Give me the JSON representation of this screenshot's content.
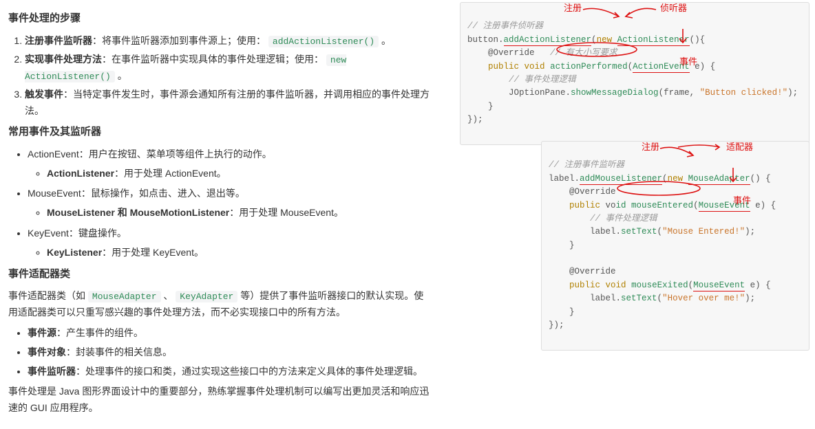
{
  "section1": {
    "title": "事件处理的步骤",
    "items": [
      {
        "label": "注册事件监听器",
        "desc": "：将事件监听器添加到事件源上；使用：",
        "code": "addActionListener()",
        "tail": "。"
      },
      {
        "label": "实现事件处理方法",
        "desc": "：在事件监听器中实现具体的事件处理逻辑；使用：",
        "code": "new ActionListener()",
        "tail": "。"
      },
      {
        "label": "触发事件",
        "desc": "：当特定事件发生时，事件源会通知所有注册的事件监听器，并调用相应的事件处理方法。",
        "code": "",
        "tail": ""
      }
    ]
  },
  "section2": {
    "title": "常用事件及其监听器",
    "items": [
      {
        "main": "ActionEvent：用户在按钮、菜单项等组件上执行的动作。",
        "sub": "ActionListener",
        "sub_tail": "：用于处理 ActionEvent。"
      },
      {
        "main": "MouseEvent：鼠标操作，如点击、进入、退出等。",
        "sub": "MouseListener 和 MouseMotionListener",
        "sub_tail": "：用于处理 MouseEvent。"
      },
      {
        "main": "KeyEvent：键盘操作。",
        "sub": "KeyListener",
        "sub_tail": "：用于处理 KeyEvent。"
      }
    ]
  },
  "section3": {
    "title": "事件适配器类",
    "intro_pre": "事件适配器类（如 ",
    "code1": "MouseAdapter",
    "intro_mid": "、",
    "code2": "KeyAdapter",
    "intro_post": " 等）提供了事件监听器接口的默认实现。使用适配器类可以只重写感兴趣的事件处理方法，而不必实现接口中的所有方法。",
    "bullets": [
      {
        "b": "事件源",
        "t": "：产生事件的组件。"
      },
      {
        "b": "事件对象",
        "t": "：封装事件的相关信息。"
      },
      {
        "b": "事件监听器",
        "t": "：处理事件的接口和类，通过实现这些接口中的方法来定义具体的事件处理逻辑。"
      }
    ],
    "footer": "事件处理是 Java 图形界面设计中的重要部分，熟练掌握事件处理机制可以编写出更加灵活和响应迅速的 GUI 应用程序。"
  },
  "snippet1": {
    "c1": "// 注册事件侦听器",
    "l1a": "button.",
    "l1b": "addActionListener",
    "l1c": "new",
    "l1d": "ActionListener",
    "l2a": "    @Override",
    "c2": "   // 有大小写要求",
    "l3a": "    public",
    "l3b": "void",
    "l3c": "actionPerformed",
    "l3d": "ActionEvent",
    "l3e": " e) {",
    "c3": "        // 事件处理逻辑",
    "l4a": "        JOptionPane.",
    "l4b": "showMessageDialog",
    "l4c": "(frame, ",
    "s1": "\"Button clicked!\"",
    "l4d": ");",
    "l5": "    }",
    "l6": "});",
    "anno": {
      "a1": "注册",
      "a2": "侦听器",
      "a3": "事件"
    }
  },
  "snippet2": {
    "c1": "// 注册事件监听器",
    "l1a": "label.",
    "l1b": "addMouseListener",
    "l1c": "new",
    "l1d": "MouseAdapter",
    "l1e": "() {",
    "l2": "    @Override",
    "l3a": "    public",
    "l3b": " vo",
    "l3c": "id ",
    "l3d": "mouseEntered",
    "l3e": "MouseEvent",
    "l3f": " e) {",
    "c2": "        // 事件处理逻辑",
    "l4a": "        label.",
    "l4b": "setText",
    "l4c": "(",
    "s1": "\"Mouse Entered!\"",
    "l4d": ");",
    "l5": "    }",
    "blank": "",
    "l6": "    @Override",
    "l7a": "    public",
    "l7b": "void",
    "l7c": "mouseExited",
    "l7d": "MouseEvent",
    "l7e": " e) {",
    "l8a": "        label.",
    "l8b": "setText",
    "l8c": "(",
    "s2": "\"Hover over me!\"",
    "l8d": ");",
    "l9": "    }",
    "l10": "});",
    "anno": {
      "a1": "注册",
      "a2": "适配器",
      "a3": "事件"
    }
  }
}
